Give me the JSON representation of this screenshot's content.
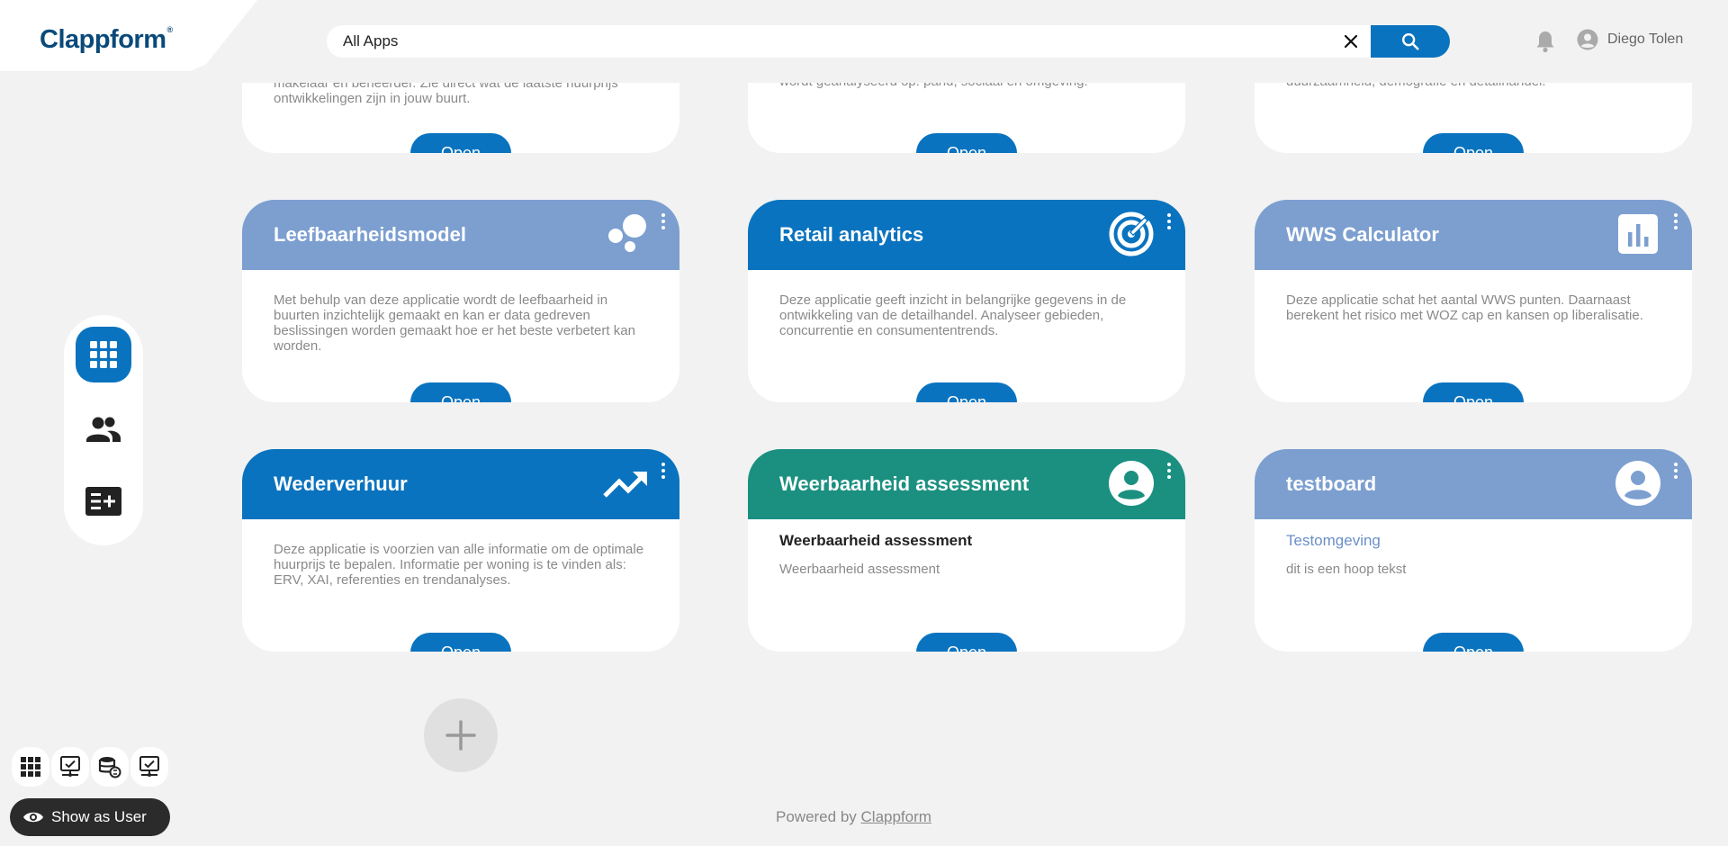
{
  "header": {
    "logo_text": "Clappform",
    "logo_reg": "®",
    "search_value": "All Apps",
    "user_name": "Diego Tolen"
  },
  "top_row": [
    {
      "desc": "makelaar en beheerder. Zie direct wat de laatste huurprijs ontwikkelingen zijn in jouw buurt.",
      "open_label": "Open"
    },
    {
      "desc": "wordt geanalyseerd op: pand, sociaal en omgeving.",
      "open_label": "Open"
    },
    {
      "desc": "duurzaamheid, demografie en detailhandel.",
      "open_label": "Open"
    }
  ],
  "cards": [
    {
      "title": "Leefbaarheidsmodel",
      "icon": "bubbles-icon",
      "color": "#7c9fd0",
      "desc": "Met behulp van deze applicatie wordt de leefbaarheid in buurten inzichtelijk gemaakt en kan er data gedreven beslissingen worden gemaakt hoe er het beste verbetert kan worden.",
      "open_label": "Open"
    },
    {
      "title": "Retail analytics",
      "icon": "target-icon",
      "color": "#0a73bf",
      "desc": "Deze applicatie geeft inzicht in belangrijke gegevens in de ontwikkeling van de detailhandel. Analyseer gebieden, concurrentie en consumententrends.",
      "open_label": "Open"
    },
    {
      "title": "WWS Calculator",
      "icon": "bar-chart-icon",
      "color": "#7c9fd0",
      "desc": "Deze applicatie schat het aantal WWS punten. Daarnaast berekent het risico met WOZ cap en kansen op liberalisatie.",
      "open_label": "Open"
    },
    {
      "title": "Wederverhuur",
      "icon": "trending-up-icon",
      "color": "#0a73bf",
      "desc": "Deze applicatie is voorzien van alle informatie om de optimale huurprijs te bepalen. Informatie per woning is te vinden als: ERV, XAI, referenties en trendanalyses.",
      "open_label": "Open"
    },
    {
      "title": "Weerbaarheid assessment",
      "icon": "user-avatar-icon",
      "color": "#1b9080",
      "subtitle": "Weerbaarheid assessment",
      "desc2": "Weerbaarheid assessment",
      "open_label": "Open"
    },
    {
      "title": "testboard",
      "icon": "user-avatar-icon",
      "color": "#7c9fd0",
      "subtitle": "Testomgeving",
      "desc2": "dit is een hoop tekst",
      "open_label": "Open"
    }
  ],
  "dev_toolbar": {
    "show_as_user_label": "Show as User"
  },
  "footer": {
    "powered_prefix": "Powered by",
    "powered_brand": "Clappform"
  }
}
